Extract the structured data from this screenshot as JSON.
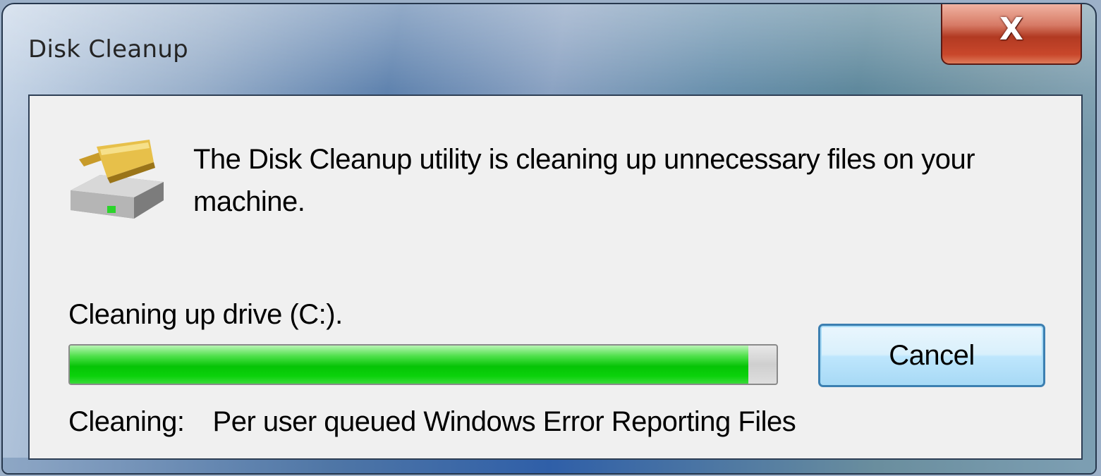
{
  "window": {
    "title": "Disk Cleanup",
    "close_label": "X"
  },
  "dialog": {
    "icon": "disk-cleanup-icon",
    "message": "The Disk Cleanup utility is cleaning up unnecessary files on your machine.",
    "drive_label": "Cleaning up drive  (C:).",
    "progress": 0.96,
    "cancel_label": "Cancel",
    "status_prefix": "Cleaning:",
    "status_item": "Per user queued Windows Error Reporting Files"
  },
  "colors": {
    "progress_green": "#06c406",
    "close_red": "#b23a22",
    "button_border": "#3c7fb1"
  }
}
